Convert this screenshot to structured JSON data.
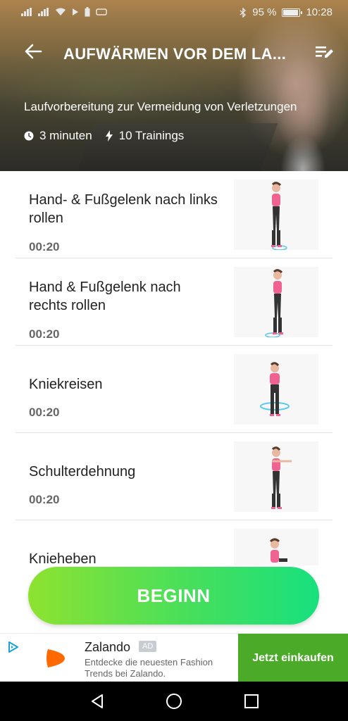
{
  "status_bar": {
    "battery_percent": "95 %",
    "time": "10:28"
  },
  "header": {
    "title": "AUFWÄRMEN VOR DEM LA...",
    "subtitle": "Laufvorbereitung zur Vermeidung von Verletzungen",
    "duration": "3 minuten",
    "trainings": "10 Trainings"
  },
  "exercises": [
    {
      "name": "Hand- & Fußgelenk nach links rollen",
      "duration": "00:20"
    },
    {
      "name": "Hand & Fußgelenk nach rechts rollen",
      "duration": "00:20"
    },
    {
      "name": "Kniekreisen",
      "duration": "00:20"
    },
    {
      "name": "Schulterdehnung",
      "duration": "00:20"
    },
    {
      "name": "Knieheben",
      "duration": ""
    }
  ],
  "begin_button": "BEGINN",
  "ad": {
    "title": "Zalando",
    "badge": "AD",
    "description": "Entdecke die neuesten Fashion Trends bei Zalando.",
    "cta": "Jetzt einkaufen"
  },
  "colors": {
    "accent_start": "#8ee230",
    "accent_end": "#18e07e",
    "ad_cta": "#4caa29",
    "zalando_orange": "#ff6900"
  }
}
